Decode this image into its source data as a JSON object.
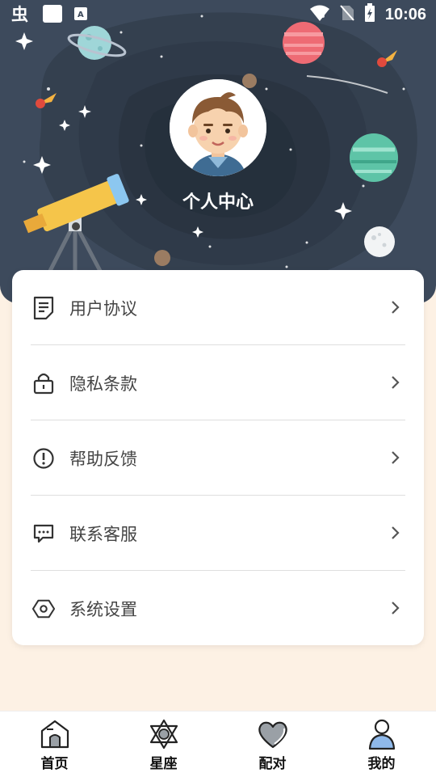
{
  "status_bar": {
    "time": "10:06"
  },
  "header": {
    "title": "个人中心"
  },
  "menu": [
    {
      "label": "用户协议",
      "icon": "document-icon"
    },
    {
      "label": "隐私条款",
      "icon": "lock-icon"
    },
    {
      "label": "帮助反馈",
      "icon": "alert-circle-icon"
    },
    {
      "label": "联系客服",
      "icon": "chat-bubble-icon"
    },
    {
      "label": "系统设置",
      "icon": "hexagon-settings-icon"
    }
  ],
  "tabbar": [
    {
      "label": "首页",
      "icon": "home-icon"
    },
    {
      "label": "星座",
      "icon": "star-of-david-icon"
    },
    {
      "label": "配对",
      "icon": "heart-icon"
    },
    {
      "label": "我的",
      "icon": "person-icon"
    }
  ],
  "colors": {
    "header_bg": "#3d4a5c",
    "page_bg": "#fdf1e4",
    "text": "#444444"
  }
}
